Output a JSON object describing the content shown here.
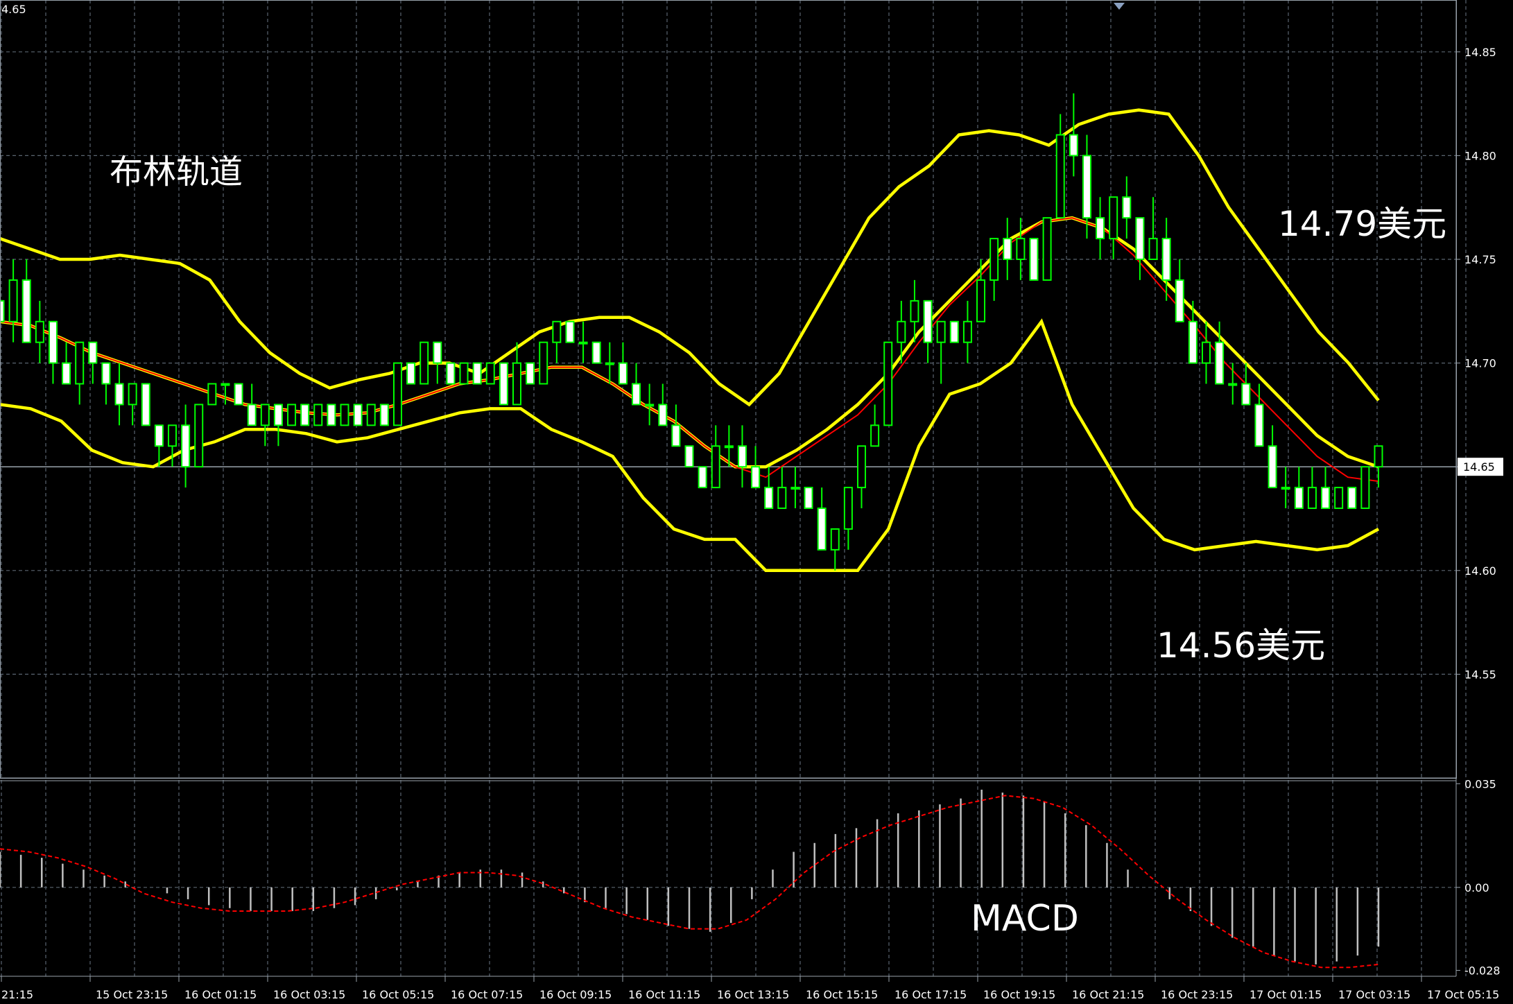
{
  "chart_data": {
    "type": "candlestick",
    "price_axis": {
      "ticks": [
        "14.85",
        "14.80",
        "14.75",
        "14.70",
        "14.65",
        "14.60",
        "14.55"
      ],
      "range": [
        14.5,
        14.875
      ],
      "current_price": "14.65",
      "top_corner_label": "4.65"
    },
    "macd_axis": {
      "ticks": [
        "0.035",
        "0.00",
        "-0.028"
      ],
      "range": [
        -0.03,
        0.036
      ]
    },
    "time_labels": [
      "21:15",
      "15 Oct 23:15",
      "16 Oct 01:15",
      "16 Oct 03:15",
      "16 Oct 05:15",
      "16 Oct 07:15",
      "16 Oct 09:15",
      "16 Oct 11:15",
      "16 Oct 13:15",
      "16 Oct 15:15",
      "16 Oct 17:15",
      "16 Oct 19:15",
      "16 Oct 21:15",
      "16 Oct 23:15",
      "17 Oct 01:15",
      "17 Oct 03:15",
      "17 Oct 05:15"
    ],
    "annotations": {
      "title": "布林轨道",
      "upper_target": "14.79美元",
      "lower_target": "14.56美元",
      "macd_label": "MACD"
    },
    "colors": {
      "background": "#000000",
      "grid": "#5a6570",
      "bull_body": "#000000",
      "bear_body": "#ffffff",
      "candle_outline": "#00ff00",
      "bollinger": "#ffff00",
      "middle_ma": "#ff0000",
      "macd_hist": "#c0c0c0",
      "macd_signal": "#ff0000",
      "text": "#ffffff"
    },
    "candles": [
      [
        14.73,
        14.75,
        14.72,
        14.72
      ],
      [
        14.72,
        14.75,
        14.71,
        14.74
      ],
      [
        14.74,
        14.75,
        14.71,
        14.71
      ],
      [
        14.71,
        14.73,
        14.7,
        14.72
      ],
      [
        14.72,
        14.72,
        14.69,
        14.7
      ],
      [
        14.7,
        14.71,
        14.69,
        14.69
      ],
      [
        14.69,
        14.71,
        14.68,
        14.71
      ],
      [
        14.71,
        14.71,
        14.69,
        14.7
      ],
      [
        14.7,
        14.7,
        14.68,
        14.69
      ],
      [
        14.69,
        14.7,
        14.67,
        14.68
      ],
      [
        14.68,
        14.69,
        14.67,
        14.69
      ],
      [
        14.69,
        14.69,
        14.67,
        14.67
      ],
      [
        14.67,
        14.67,
        14.65,
        14.66
      ],
      [
        14.66,
        14.67,
        14.65,
        14.67
      ],
      [
        14.67,
        14.68,
        14.64,
        14.65
      ],
      [
        14.65,
        14.68,
        14.65,
        14.68
      ],
      [
        14.68,
        14.69,
        14.68,
        14.69
      ],
      [
        14.69,
        14.69,
        14.68,
        14.69
      ],
      [
        14.69,
        14.69,
        14.68,
        14.68
      ],
      [
        14.68,
        14.69,
        14.67,
        14.67
      ],
      [
        14.67,
        14.68,
        14.66,
        14.68
      ],
      [
        14.68,
        14.68,
        14.66,
        14.67
      ],
      [
        14.67,
        14.68,
        14.67,
        14.68
      ],
      [
        14.68,
        14.68,
        14.67,
        14.67
      ],
      [
        14.67,
        14.68,
        14.67,
        14.68
      ],
      [
        14.68,
        14.68,
        14.67,
        14.67
      ],
      [
        14.67,
        14.68,
        14.67,
        14.68
      ],
      [
        14.68,
        14.68,
        14.67,
        14.67
      ],
      [
        14.67,
        14.68,
        14.67,
        14.68
      ],
      [
        14.68,
        14.68,
        14.67,
        14.67
      ],
      [
        14.67,
        14.7,
        14.67,
        14.7
      ],
      [
        14.7,
        14.7,
        14.69,
        14.69
      ],
      [
        14.69,
        14.71,
        14.69,
        14.71
      ],
      [
        14.71,
        14.71,
        14.69,
        14.7
      ],
      [
        14.7,
        14.7,
        14.69,
        14.69
      ],
      [
        14.69,
        14.7,
        14.69,
        14.7
      ],
      [
        14.7,
        14.7,
        14.69,
        14.69
      ],
      [
        14.69,
        14.7,
        14.69,
        14.7
      ],
      [
        14.7,
        14.7,
        14.68,
        14.68
      ],
      [
        14.68,
        14.71,
        14.68,
        14.7
      ],
      [
        14.7,
        14.7,
        14.69,
        14.69
      ],
      [
        14.69,
        14.71,
        14.69,
        14.71
      ],
      [
        14.71,
        14.72,
        14.7,
        14.72
      ],
      [
        14.72,
        14.72,
        14.71,
        14.71
      ],
      [
        14.71,
        14.72,
        14.7,
        14.71
      ],
      [
        14.71,
        14.71,
        14.7,
        14.7
      ],
      [
        14.7,
        14.71,
        14.69,
        14.7
      ],
      [
        14.7,
        14.71,
        14.69,
        14.69
      ],
      [
        14.69,
        14.7,
        14.68,
        14.68
      ],
      [
        14.68,
        14.69,
        14.67,
        14.68
      ],
      [
        14.68,
        14.69,
        14.67,
        14.67
      ],
      [
        14.67,
        14.68,
        14.66,
        14.66
      ],
      [
        14.66,
        14.66,
        14.65,
        14.65
      ],
      [
        14.65,
        14.65,
        14.64,
        14.64
      ],
      [
        14.64,
        14.67,
        14.64,
        14.66
      ],
      [
        14.66,
        14.67,
        14.65,
        14.66
      ],
      [
        14.66,
        14.67,
        14.64,
        14.65
      ],
      [
        14.65,
        14.66,
        14.64,
        14.64
      ],
      [
        14.64,
        14.65,
        14.63,
        14.63
      ],
      [
        14.63,
        14.65,
        14.63,
        14.64
      ],
      [
        14.64,
        14.65,
        14.63,
        14.64
      ],
      [
        14.64,
        14.64,
        14.63,
        14.63
      ],
      [
        14.63,
        14.64,
        14.61,
        14.61
      ],
      [
        14.61,
        14.62,
        14.6,
        14.62
      ],
      [
        14.62,
        14.64,
        14.61,
        14.64
      ],
      [
        14.64,
        14.66,
        14.63,
        14.66
      ],
      [
        14.66,
        14.68,
        14.66,
        14.67
      ],
      [
        14.67,
        14.71,
        14.67,
        14.71
      ],
      [
        14.71,
        14.73,
        14.7,
        14.72
      ],
      [
        14.72,
        14.74,
        14.71,
        14.73
      ],
      [
        14.73,
        14.73,
        14.7,
        14.71
      ],
      [
        14.71,
        14.72,
        14.69,
        14.72
      ],
      [
        14.72,
        14.72,
        14.71,
        14.71
      ],
      [
        14.71,
        14.73,
        14.7,
        14.72
      ],
      [
        14.72,
        14.75,
        14.72,
        14.74
      ],
      [
        14.74,
        14.76,
        14.73,
        14.76
      ],
      [
        14.76,
        14.77,
        14.74,
        14.75
      ],
      [
        14.75,
        14.77,
        14.74,
        14.76
      ],
      [
        14.76,
        14.76,
        14.74,
        14.74
      ],
      [
        14.74,
        14.77,
        14.74,
        14.77
      ],
      [
        14.77,
        14.82,
        14.77,
        14.81
      ],
      [
        14.81,
        14.83,
        14.79,
        14.8
      ],
      [
        14.8,
        14.81,
        14.76,
        14.77
      ],
      [
        14.77,
        14.78,
        14.75,
        14.76
      ],
      [
        14.76,
        14.78,
        14.75,
        14.78
      ],
      [
        14.78,
        14.79,
        14.76,
        14.77
      ],
      [
        14.77,
        14.77,
        14.74,
        14.75
      ],
      [
        14.75,
        14.78,
        14.75,
        14.76
      ],
      [
        14.76,
        14.77,
        14.73,
        14.74
      ],
      [
        14.74,
        14.75,
        14.72,
        14.72
      ],
      [
        14.72,
        14.73,
        14.7,
        14.7
      ],
      [
        14.7,
        14.72,
        14.69,
        14.71
      ],
      [
        14.71,
        14.72,
        14.69,
        14.69
      ],
      [
        14.69,
        14.7,
        14.68,
        14.69
      ],
      [
        14.69,
        14.7,
        14.68,
        14.68
      ],
      [
        14.68,
        14.69,
        14.66,
        14.66
      ],
      [
        14.66,
        14.67,
        14.64,
        14.64
      ],
      [
        14.64,
        14.65,
        14.63,
        14.64
      ],
      [
        14.64,
        14.65,
        14.63,
        14.63
      ],
      [
        14.63,
        14.65,
        14.63,
        14.64
      ],
      [
        14.64,
        14.65,
        14.63,
        14.63
      ],
      [
        14.63,
        14.64,
        14.63,
        14.64
      ],
      [
        14.64,
        14.64,
        14.63,
        14.63
      ],
      [
        14.63,
        14.65,
        14.63,
        14.65
      ],
      [
        14.65,
        14.66,
        14.64,
        14.66
      ]
    ],
    "bollinger_upper": [
      14.76,
      14.755,
      14.75,
      14.75,
      14.752,
      14.75,
      14.748,
      14.74,
      14.72,
      14.705,
      14.695,
      14.688,
      14.692,
      14.695,
      14.7,
      14.7,
      14.695,
      14.705,
      14.715,
      14.72,
      14.722,
      14.722,
      14.715,
      14.705,
      14.69,
      14.68,
      14.695,
      14.72,
      14.745,
      14.77,
      14.785,
      14.795,
      14.81,
      14.812,
      14.81,
      14.805,
      14.815,
      14.82,
      14.822,
      14.82,
      14.8,
      14.775,
      14.755,
      14.735,
      14.715,
      14.7,
      14.682
    ],
    "bollinger_middle": [
      14.72,
      14.718,
      14.712,
      14.705,
      14.7,
      14.695,
      14.69,
      14.685,
      14.68,
      14.678,
      14.676,
      14.675,
      14.676,
      14.68,
      14.685,
      14.69,
      14.692,
      14.695,
      14.698,
      14.698,
      14.69,
      14.68,
      14.672,
      14.66,
      14.65,
      14.65,
      14.658,
      14.668,
      14.68,
      14.695,
      14.715,
      14.73,
      14.745,
      14.76,
      14.768,
      14.77,
      14.765,
      14.755,
      14.74,
      14.725,
      14.71,
      14.695,
      14.68,
      14.665,
      14.655,
      14.65
    ],
    "bollinger_lower": [
      14.68,
      14.678,
      14.672,
      14.658,
      14.652,
      14.65,
      14.658,
      14.662,
      14.668,
      14.668,
      14.666,
      14.662,
      14.664,
      14.668,
      14.672,
      14.676,
      14.678,
      14.678,
      14.668,
      14.662,
      14.655,
      14.635,
      14.62,
      14.615,
      14.615,
      14.6,
      14.6,
      14.6,
      14.6,
      14.62,
      14.66,
      14.685,
      14.69,
      14.7,
      14.72,
      14.68,
      14.655,
      14.63,
      14.615,
      14.61,
      14.612,
      14.614,
      14.612,
      14.61,
      14.612,
      14.62
    ],
    "middle_ma": [
      14.72,
      14.718,
      14.712,
      14.705,
      14.7,
      14.695,
      14.69,
      14.685,
      14.68,
      14.678,
      14.676,
      14.675,
      14.676,
      14.68,
      14.685,
      14.69,
      14.692,
      14.695,
      14.698,
      14.698,
      14.69,
      14.68,
      14.672,
      14.66,
      14.65,
      14.645,
      14.655,
      14.665,
      14.675,
      14.69,
      14.71,
      14.728,
      14.742,
      14.758,
      14.768,
      14.77,
      14.765,
      14.752,
      14.735,
      14.718,
      14.7,
      14.685,
      14.67,
      14.655,
      14.645,
      14.643
    ],
    "macd_hist": [
      0.012,
      0.011,
      0.01,
      0.008,
      0.006,
      0.004,
      0.002,
      0.0,
      -0.002,
      -0.004,
      -0.006,
      -0.007,
      -0.008,
      -0.008,
      -0.008,
      -0.008,
      -0.007,
      -0.006,
      -0.004,
      -0.001,
      0.002,
      0.004,
      0.005,
      0.006,
      0.006,
      0.005,
      0.002,
      -0.002,
      -0.005,
      -0.007,
      -0.009,
      -0.011,
      -0.013,
      -0.014,
      -0.015,
      -0.012,
      -0.004,
      0.006,
      0.012,
      0.015,
      0.018,
      0.02,
      0.023,
      0.025,
      0.026,
      0.028,
      0.03,
      0.033,
      0.032,
      0.031,
      0.029,
      0.025,
      0.021,
      0.015,
      0.006,
      0.0,
      -0.004,
      -0.008,
      -0.013,
      -0.017,
      -0.02,
      -0.023,
      -0.025,
      -0.026,
      -0.025,
      -0.023,
      -0.02
    ],
    "macd_signal": [
      0.013,
      0.012,
      0.01,
      0.007,
      0.003,
      -0.002,
      -0.005,
      -0.007,
      -0.008,
      -0.008,
      -0.008,
      -0.007,
      -0.005,
      -0.002,
      0.001,
      0.003,
      0.005,
      0.005,
      0.004,
      0.001,
      -0.003,
      -0.007,
      -0.01,
      -0.012,
      -0.014,
      -0.014,
      -0.011,
      -0.004,
      0.005,
      0.012,
      0.017,
      0.021,
      0.024,
      0.027,
      0.029,
      0.031,
      0.03,
      0.027,
      0.021,
      0.013,
      0.004,
      -0.004,
      -0.011,
      -0.017,
      -0.022,
      -0.025,
      -0.027,
      -0.027,
      -0.026
    ]
  }
}
